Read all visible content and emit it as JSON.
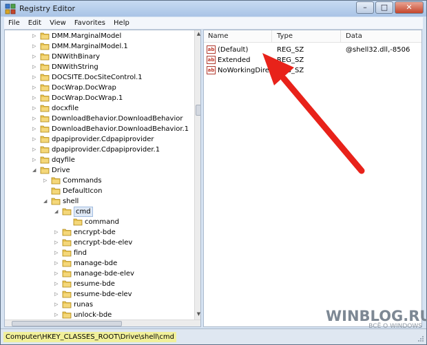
{
  "window": {
    "title": "Registry Editor",
    "minimize": "–",
    "maximize": "□",
    "close": "✕"
  },
  "menu": [
    "File",
    "Edit",
    "View",
    "Favorites",
    "Help"
  ],
  "tree": [
    {
      "label": "DMM.MarginalModel",
      "level": 0,
      "expander": "collapsed"
    },
    {
      "label": "DMM.MarginalModel.1",
      "level": 0,
      "expander": "collapsed"
    },
    {
      "label": "DNWithBinary",
      "level": 0,
      "expander": "collapsed"
    },
    {
      "label": "DNWithString",
      "level": 0,
      "expander": "collapsed"
    },
    {
      "label": "DOCSITE.DocSiteControl.1",
      "level": 0,
      "expander": "collapsed"
    },
    {
      "label": "DocWrap.DocWrap",
      "level": 0,
      "expander": "collapsed"
    },
    {
      "label": "DocWrap.DocWrap.1",
      "level": 0,
      "expander": "collapsed"
    },
    {
      "label": "docxfile",
      "level": 0,
      "expander": "collapsed"
    },
    {
      "label": "DownloadBehavior.DownloadBehavior",
      "level": 0,
      "expander": "collapsed"
    },
    {
      "label": "DownloadBehavior.DownloadBehavior.1",
      "level": 0,
      "expander": "collapsed"
    },
    {
      "label": "dpapiprovider.Cdpapiprovider",
      "level": 0,
      "expander": "collapsed"
    },
    {
      "label": "dpapiprovider.Cdpapiprovider.1",
      "level": 0,
      "expander": "collapsed"
    },
    {
      "label": "dqyfile",
      "level": 0,
      "expander": "collapsed"
    },
    {
      "label": "Drive",
      "level": 0,
      "expander": "expanded"
    },
    {
      "label": "Commands",
      "level": 1,
      "expander": "collapsed"
    },
    {
      "label": "DefaultIcon",
      "level": 1,
      "expander": "none"
    },
    {
      "label": "shell",
      "level": 1,
      "expander": "expanded"
    },
    {
      "label": "cmd",
      "level": 2,
      "expander": "expanded",
      "selected": true
    },
    {
      "label": "command",
      "level": 3,
      "expander": "none"
    },
    {
      "label": "encrypt-bde",
      "level": 2,
      "expander": "collapsed"
    },
    {
      "label": "encrypt-bde-elev",
      "level": 2,
      "expander": "collapsed"
    },
    {
      "label": "find",
      "level": 2,
      "expander": "collapsed"
    },
    {
      "label": "manage-bde",
      "level": 2,
      "expander": "collapsed"
    },
    {
      "label": "manage-bde-elev",
      "level": 2,
      "expander": "collapsed"
    },
    {
      "label": "resume-bde",
      "level": 2,
      "expander": "collapsed"
    },
    {
      "label": "resume-bde-elev",
      "level": 2,
      "expander": "collapsed"
    },
    {
      "label": "runas",
      "level": 2,
      "expander": "collapsed"
    },
    {
      "label": "unlock-bde",
      "level": 2,
      "expander": "collapsed"
    }
  ],
  "list": {
    "headers": {
      "name": "Name",
      "type": "Type",
      "data": "Data"
    },
    "rows": [
      {
        "icon": "ab",
        "name": "(Default)",
        "type": "REG_SZ",
        "data": "@shell32.dll,-8506"
      },
      {
        "icon": "ab",
        "name": "Extended",
        "type": "REG_SZ",
        "data": ""
      },
      {
        "icon": "ab",
        "name": "NoWorkingDire...",
        "type": "REG_SZ",
        "data": ""
      }
    ]
  },
  "status": {
    "path": "Computer\\HKEY_CLASSES_ROOT\\Drive\\shell\\cmd"
  },
  "watermark": {
    "main": "WINBLOG.RU",
    "sub": "ВСЁ О WINDOWS"
  },
  "annotation": {
    "arrow_icon": "red-arrow-icon",
    "color": "#e8221a"
  },
  "colors": {
    "selection_bg": "#dfe9f6",
    "status_highlight": "#f1f09a",
    "folder": "#e7c250"
  }
}
